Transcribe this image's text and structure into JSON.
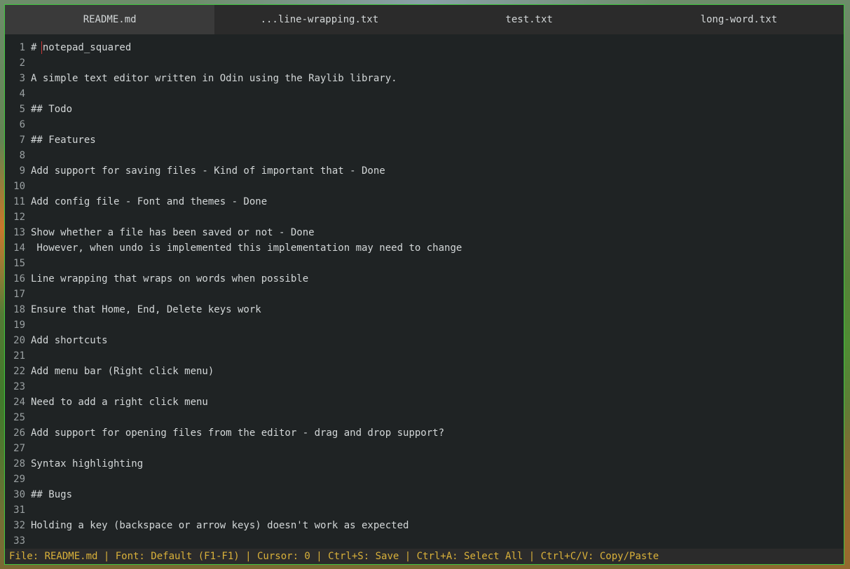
{
  "tabs": [
    {
      "label": "README.md",
      "active": true
    },
    {
      "label": "...line-wrapping.txt",
      "active": false
    },
    {
      "label": "test.txt",
      "active": false
    },
    {
      "label": "long-word.txt",
      "active": false
    }
  ],
  "editor": {
    "lines": [
      {
        "n": "1",
        "text": "# notepad_squared"
      },
      {
        "n": "2",
        "text": ""
      },
      {
        "n": "3",
        "text": "A simple text editor written in Odin using the Raylib library."
      },
      {
        "n": "4",
        "text": ""
      },
      {
        "n": "5",
        "text": "## Todo"
      },
      {
        "n": "6",
        "text": ""
      },
      {
        "n": "7",
        "text": "## Features"
      },
      {
        "n": "8",
        "text": ""
      },
      {
        "n": "9",
        "text": "Add support for saving files - Kind of important that - Done"
      },
      {
        "n": "10",
        "text": ""
      },
      {
        "n": "11",
        "text": "Add config file - Font and themes - Done"
      },
      {
        "n": "12",
        "text": ""
      },
      {
        "n": "13",
        "text": "Show whether a file has been saved or not - Done"
      },
      {
        "n": "14",
        "text": " However, when undo is implemented this implementation may need to change"
      },
      {
        "n": "15",
        "text": ""
      },
      {
        "n": "16",
        "text": "Line wrapping that wraps on words when possible"
      },
      {
        "n": "17",
        "text": ""
      },
      {
        "n": "18",
        "text": "Ensure that Home, End, Delete keys work"
      },
      {
        "n": "19",
        "text": ""
      },
      {
        "n": "20",
        "text": "Add shortcuts"
      },
      {
        "n": "21",
        "text": ""
      },
      {
        "n": "22",
        "text": "Add menu bar (Right click menu)"
      },
      {
        "n": "23",
        "text": ""
      },
      {
        "n": "24",
        "text": "Need to add a right click menu"
      },
      {
        "n": "25",
        "text": ""
      },
      {
        "n": "26",
        "text": "Add support for opening files from the editor - drag and drop support?"
      },
      {
        "n": "27",
        "text": ""
      },
      {
        "n": "28",
        "text": "Syntax highlighting"
      },
      {
        "n": "29",
        "text": ""
      },
      {
        "n": "30",
        "text": "## Bugs"
      },
      {
        "n": "31",
        "text": ""
      },
      {
        "n": "32",
        "text": "Holding a key (backspace or arrow keys) doesn't work as expected"
      },
      {
        "n": "33",
        "text": ""
      }
    ]
  },
  "status": {
    "text": "File: README.md | Font: Default (F1-F1) | Cursor: 0 | Ctrl+S: Save | Ctrl+A: Select All | Ctrl+C/V: Copy/Paste"
  },
  "colors": {
    "border": "#3fc53f",
    "editor_bg": "#1f2324",
    "tab_bg": "#2b2b2b",
    "tab_active_bg": "#3a3a3a",
    "text": "#d3d7d8",
    "status_text": "#d9b13a",
    "cursor": "#c83a3a"
  }
}
